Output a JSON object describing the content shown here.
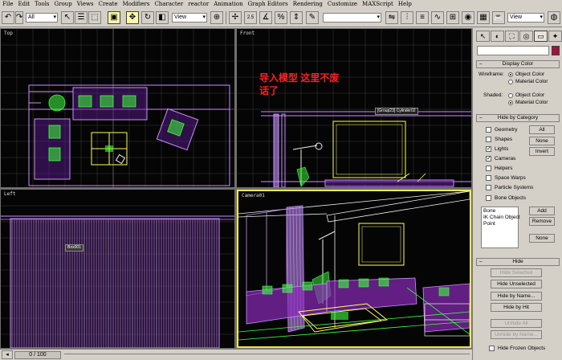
{
  "menu": [
    "File",
    "Edit",
    "Tools",
    "Group",
    "Views",
    "Create",
    "Modifiers",
    "Character",
    "reactor",
    "Animation",
    "Graph Editors",
    "Rendering",
    "Customize",
    "MAXScript",
    "Help"
  ],
  "toolbar": {
    "selection_filter": "All",
    "reference_coord": "View",
    "named_selection": "",
    "render_view": "View",
    "snap_value": "2.5"
  },
  "viewports": {
    "top_label": "Top",
    "front_label": "Front",
    "left_label": "Left",
    "camera_label": "Camera01",
    "red_overlay_line1": "导入模型  这里不废",
    "red_overlay_line2": "话了",
    "front_tag": "[Group23] Cylinder02",
    "left_tag": "Box001"
  },
  "statusbar": {
    "time_slider": "0 / 100"
  },
  "command_panel": {
    "display_color": {
      "title": "Display Color",
      "wireframe_label": "Wireframe:",
      "shaded_label": "Shaded:",
      "object_color": "Object Color",
      "material_color": "Material Color"
    },
    "hide_by_category": {
      "title": "Hide by Category",
      "items": [
        {
          "label": "Geometry",
          "checked": false
        },
        {
          "label": "Shapes",
          "checked": false
        },
        {
          "label": "Lights",
          "checked": true
        },
        {
          "label": "Cameras",
          "checked": true
        },
        {
          "label": "Helpers",
          "checked": false
        },
        {
          "label": "Space Warps",
          "checked": false
        },
        {
          "label": "Particle Systems",
          "checked": false
        },
        {
          "label": "Bone Objects",
          "checked": false
        }
      ],
      "all_button": "All",
      "none_button": "None",
      "invert_button": "Invert",
      "list_items": [
        "Bone",
        "IK Chain Object",
        "Point"
      ],
      "add_button": "Add",
      "remove_button": "Remove",
      "none2_button": "None"
    },
    "hide": {
      "title": "Hide",
      "hide_selected": "Hide Selected",
      "hide_unselected": "Hide Unselected",
      "hide_by_name": "Hide by Name...",
      "hide_by_hit": "Hide by Hit",
      "unhide_all": "Unhide All",
      "unhide_by_name": "Unhide by Name...",
      "hide_frozen": "Hide Frozen Objects"
    }
  },
  "colors": {
    "wire_purple": "#c890ff",
    "wire_green": "#40ff40",
    "wire_yellow": "#ffff60",
    "wire_white": "#f0f0f0",
    "grid": "#3a3a3a"
  }
}
